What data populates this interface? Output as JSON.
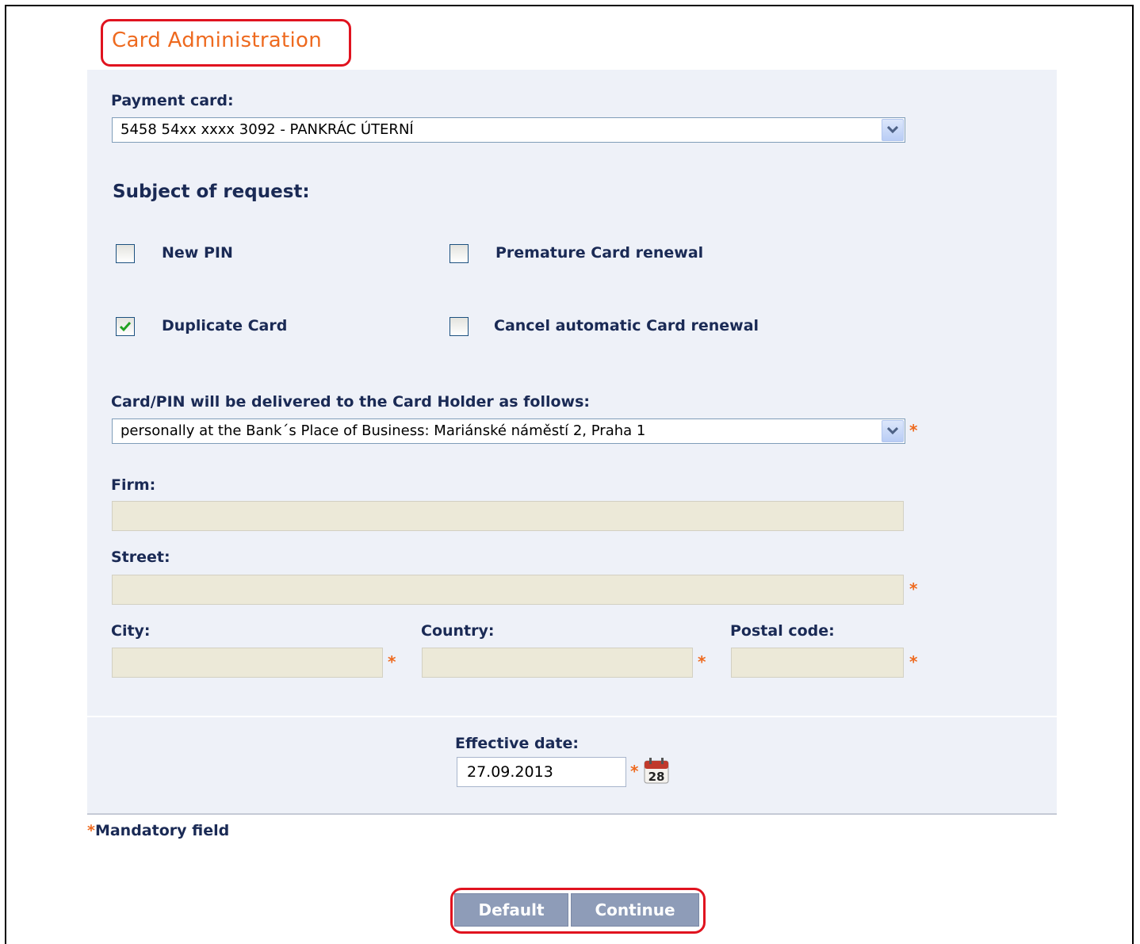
{
  "tab": {
    "title": "Card Administration"
  },
  "payment_card": {
    "label": "Payment card:",
    "selected": "5458 54xx xxxx 3092 - PANKRÁC ÚTERNÍ"
  },
  "subject": {
    "heading": "Subject of request:",
    "options": [
      {
        "label": "New PIN",
        "checked": false
      },
      {
        "label": "Premature Card renewal",
        "checked": false
      },
      {
        "label": "Duplicate Card",
        "checked": true
      },
      {
        "label": "Cancel automatic Card renewal",
        "checked": false
      }
    ]
  },
  "delivery": {
    "label": "Card/PIN will be delivered to the Card Holder as follows:",
    "selected": "personally at the Bank´s Place of Business: Mariánské náměstí 2, Praha 1"
  },
  "address": {
    "firm_label": "Firm:",
    "street_label": "Street:",
    "city_label": "City:",
    "country_label": "Country:",
    "postal_label": "Postal code:"
  },
  "effective_date": {
    "label": "Effective date:",
    "value": "27.09.2013",
    "calendar_day": "28"
  },
  "mandatory": {
    "star": "*",
    "text": "Mandatory field"
  },
  "buttons": {
    "default_label": "Default",
    "continue_label": "Continue"
  },
  "colors": {
    "accent": "#ee6a1f",
    "highlight": "#e0131f",
    "panel": "#eef1f8",
    "label": "#1a2a55",
    "button": "#8e9cb8",
    "disabled_field": "#ece9d8"
  }
}
